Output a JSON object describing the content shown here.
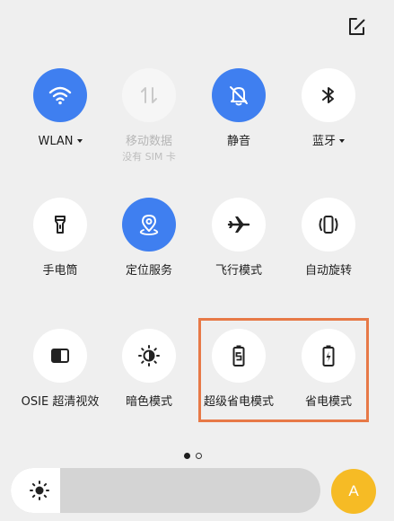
{
  "header": {
    "edit_icon": "edit-icon"
  },
  "tiles": [
    {
      "label": "WLAN",
      "icon": "wifi-icon",
      "state": "on",
      "has_caret": true
    },
    {
      "label": "移动数据",
      "sublabel": "没有 SIM 卡",
      "icon": "mobile-data-icon",
      "state": "disabled"
    },
    {
      "label": "静音",
      "icon": "bell-off-icon",
      "state": "on"
    },
    {
      "label": "蓝牙",
      "icon": "bluetooth-icon",
      "state": "off",
      "has_caret": true
    },
    {
      "label": "手电筒",
      "icon": "flashlight-icon",
      "state": "off"
    },
    {
      "label": "定位服务",
      "icon": "location-icon",
      "state": "on"
    },
    {
      "label": "飞行模式",
      "icon": "airplane-icon",
      "state": "off"
    },
    {
      "label": "自动旋转",
      "icon": "rotate-icon",
      "state": "off"
    },
    {
      "label": "OSIE 超清视效",
      "icon": "osie-icon",
      "state": "off"
    },
    {
      "label": "暗色模式",
      "icon": "dark-mode-icon",
      "state": "off"
    },
    {
      "label": "超级省电模式",
      "icon": "super-power-saving-icon",
      "state": "off"
    },
    {
      "label": "省电模式",
      "icon": "power-saving-icon",
      "state": "off"
    }
  ],
  "pagination": {
    "current": 1,
    "total": 2
  },
  "brightness": {
    "level": 0.16,
    "icon": "brightness-icon"
  },
  "auto_brightness": {
    "label": "A"
  },
  "colors": {
    "accent_blue": "#3f7ff0",
    "highlight_orange": "#e77947",
    "auto_yellow": "#f6bb25",
    "background": "#efefef"
  }
}
